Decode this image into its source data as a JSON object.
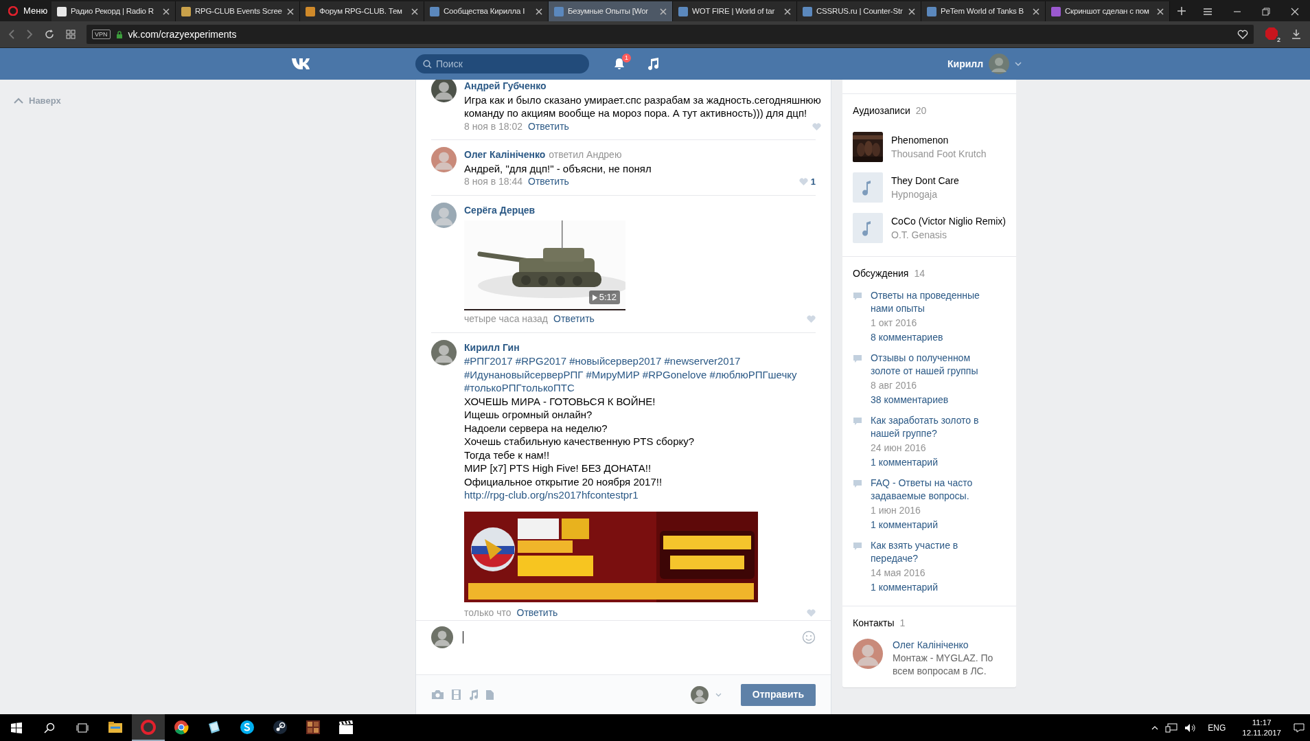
{
  "browser": {
    "menu_label": "Меню",
    "tabs": [
      {
        "title": "Радио Рекорд | Radio R",
        "selected": false,
        "color": "#e8e8e8"
      },
      {
        "title": "RPG-CLUB Events Scree",
        "selected": false,
        "color": "#c9a14a"
      },
      {
        "title": "Форум RPG-CLUB. Тем",
        "selected": false,
        "color": "#d08a2a"
      },
      {
        "title": "Сообщества Кирилла I",
        "selected": false,
        "color": "#5b88bd"
      },
      {
        "title": "Безумные Опыты [Wor",
        "selected": true,
        "color": "#5b88bd"
      },
      {
        "title": "WOT FIRE | World of tar",
        "selected": false,
        "color": "#5b88bd"
      },
      {
        "title": "CSSRUS.ru | Counter-Str",
        "selected": false,
        "color": "#5b88bd"
      },
      {
        "title": "PeTem World of Tanks B",
        "selected": false,
        "color": "#5b88bd"
      },
      {
        "title": "Скриншот сделан с пом",
        "selected": false,
        "color": "#9b59d0"
      }
    ],
    "vpn_label": "VPN",
    "address": "vk.com/crazyexperiments",
    "adblock_count": "2"
  },
  "header": {
    "search_placeholder": "Поиск",
    "notification_count": "1",
    "user_name": "Кирилл"
  },
  "back_to_top": "Наверх",
  "comments": [
    {
      "author": "Андрей Губченко",
      "lines": [
        {
          "kind": "plain",
          "text": "Игра как и было сказано умирает.спс разрабам за жадность.сегодняшнюю"
        },
        {
          "kind": "plain",
          "text": "команду по акциям вообще на мороз пора. А тут активность))) для дцп!"
        }
      ],
      "time": "8 ноя в 18:02",
      "reply_label": "Ответить"
    },
    {
      "author": "Олег Калініченко",
      "reply_to": "ответил Андрею",
      "lines": [
        {
          "kind": "plain",
          "text": "Андрей, \"для дцп!\" - объясни, не понял"
        }
      ],
      "time": "8 ноя в 18:44",
      "reply_label": "Ответить",
      "likes": "1"
    },
    {
      "author": "Серёга Дерцев",
      "attachment": {
        "kind": "video",
        "duration": "5:12"
      },
      "time": "четыре часа назад",
      "reply_label": "Ответить"
    },
    {
      "author": "Кирилл Гин",
      "lines": [
        {
          "kind": "hashtags",
          "text": "#РПГ2017 #RPG2017 #новыйсервер2017 #newserver2017"
        },
        {
          "kind": "hashtags",
          "text": "#ИдунановыйсерверРПГ #МируМИР #RPGonelove #люблюРПГшечку"
        },
        {
          "kind": "hashtags",
          "text": "#толькоРПГтолькоПТС"
        },
        {
          "kind": "plain",
          "text": "ХОЧЕШЬ МИРА - ГОТОВЬСЯ К ВОЙНЕ!"
        },
        {
          "kind": "plain",
          "text": "Ищешь огромный онлайн?"
        },
        {
          "kind": "plain",
          "text": "Надоели сервера на неделю?"
        },
        {
          "kind": "plain",
          "text": "Хочешь стабильную качественную PTS сборку?"
        },
        {
          "kind": "plain",
          "text": "Тогда тебе к нам!!"
        },
        {
          "kind": "plain",
          "text": "МИР [x7] PTS High Five! БЕЗ ДОНАТА!!"
        },
        {
          "kind": "plain",
          "text": "Официальное открытие 20 ноября 2017!!"
        },
        {
          "kind": "link",
          "text": "http://rpg-club.org/ns2017hfcontestpr1"
        }
      ],
      "time": "только что",
      "reply_label": "Ответить"
    }
  ],
  "composer": {
    "send_label": "Отправить"
  },
  "sidebar": {
    "audio": {
      "title": "Аудиозаписи",
      "count": "20",
      "tracks": [
        {
          "kind": "cover",
          "title": "Phenomenon",
          "artist": "Thousand Foot Krutch"
        },
        {
          "kind": "note",
          "title": "They Dont Care",
          "artist": "Hypnogaja"
        },
        {
          "kind": "note",
          "title": "CoCo (Victor Niglio Remix)",
          "artist": "O.T. Genasis"
        }
      ]
    },
    "discussions": {
      "title": "Обсуждения",
      "count": "14",
      "topics": [
        {
          "title": "Ответы на проведенные нами опыты",
          "date": "1 окт 2016",
          "comments": "8 комментариев"
        },
        {
          "title": "Отзывы о полученном золоте от нашей группы",
          "date": "8 авг 2016",
          "comments": "38 комментариев"
        },
        {
          "title": "Как заработать золото в нашей группе?",
          "date": "24 июн 2016",
          "comments": "1 комментарий"
        },
        {
          "title": "FAQ - Ответы на часто задаваемые вопросы.",
          "date": "1 июн 2016",
          "comments": "1 комментарий"
        },
        {
          "title": "Как взять участие в передаче?",
          "date": "14 мая 2016",
          "comments": "1 комментарий"
        }
      ]
    },
    "contacts": {
      "title": "Контакты",
      "count": "1",
      "people": [
        {
          "name": "Олег Калініченко",
          "description": "Монтаж - MYGLAZ. По всем вопросам в ЛС."
        }
      ]
    }
  },
  "taskbar": {
    "apps": [
      {
        "kind": "explorer"
      },
      {
        "kind": "opera",
        "selected": true
      },
      {
        "kind": "chrome",
        "selected": false
      },
      {
        "kind": "notepad",
        "selected": false
      },
      {
        "kind": "skype",
        "selected": false
      },
      {
        "kind": "steam",
        "selected": false
      },
      {
        "kind": "game",
        "selected": false
      },
      {
        "kind": "clapper",
        "selected": false
      }
    ],
    "language": "ENG",
    "time": "11:17",
    "date": "12.11.2017"
  }
}
